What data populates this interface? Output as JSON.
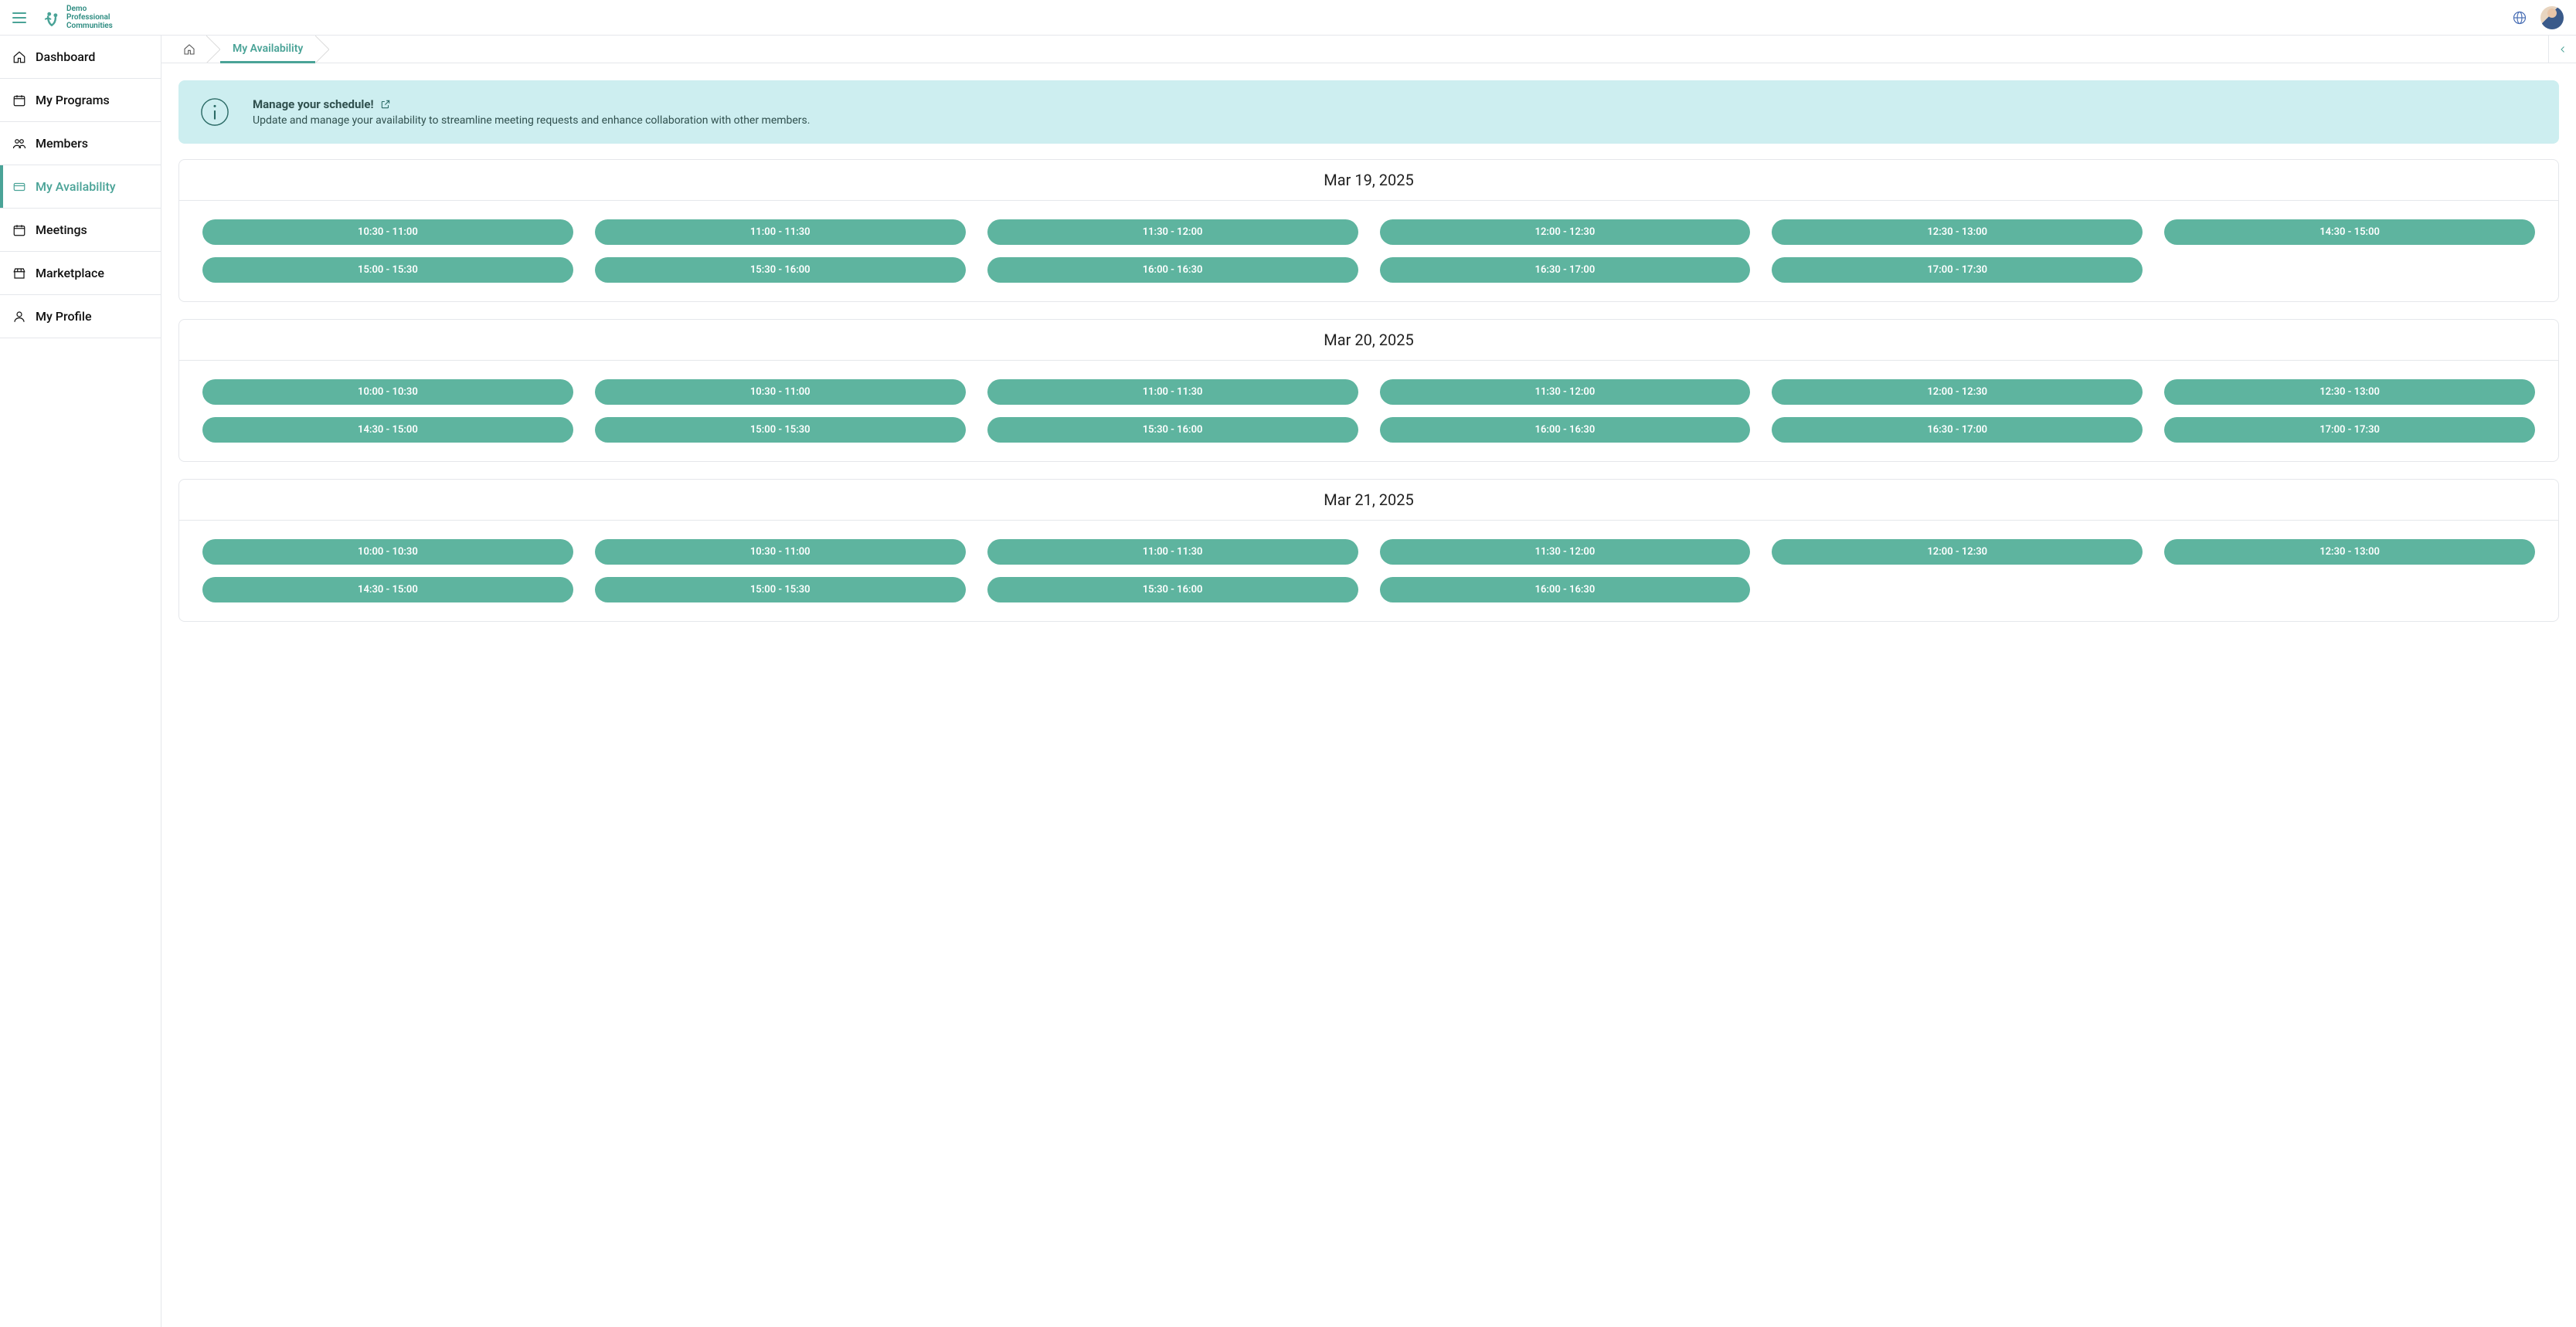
{
  "brand": {
    "line1": "Demo",
    "line2": "Professional",
    "line3": "Communities"
  },
  "sidebar": {
    "items": [
      {
        "label": "Dashboard",
        "icon": "home"
      },
      {
        "label": "My Programs",
        "icon": "calendar"
      },
      {
        "label": "Members",
        "icon": "users"
      },
      {
        "label": "My Availability",
        "icon": "card",
        "active": true
      },
      {
        "label": "Meetings",
        "icon": "calendar"
      },
      {
        "label": "Marketplace",
        "icon": "store"
      },
      {
        "label": "My Profile",
        "icon": "user"
      }
    ]
  },
  "breadcrumb": {
    "current": "My Availability"
  },
  "banner": {
    "title": "Manage your schedule!",
    "description": "Update and manage your availability to streamline meeting requests and enhance collaboration with other members."
  },
  "days": [
    {
      "date": "Mar 19, 2025",
      "slots": [
        "10:30 - 11:00",
        "11:00 - 11:30",
        "11:30 - 12:00",
        "12:00 - 12:30",
        "12:30 - 13:00",
        "14:30 - 15:00",
        "15:00 - 15:30",
        "15:30 - 16:00",
        "16:00 - 16:30",
        "16:30 - 17:00",
        "17:00 - 17:30"
      ]
    },
    {
      "date": "Mar 20, 2025",
      "slots": [
        "10:00 - 10:30",
        "10:30 - 11:00",
        "11:00 - 11:30",
        "11:30 - 12:00",
        "12:00 - 12:30",
        "12:30 - 13:00",
        "14:30 - 15:00",
        "15:00 - 15:30",
        "15:30 - 16:00",
        "16:00 - 16:30",
        "16:30 - 17:00",
        "17:00 - 17:30"
      ]
    },
    {
      "date": "Mar 21, 2025",
      "slots": [
        "10:00 - 10:30",
        "10:30 - 11:00",
        "11:00 - 11:30",
        "11:30 - 12:00",
        "12:00 - 12:30",
        "12:30 - 13:00",
        "14:30 - 15:00",
        "15:00 - 15:30",
        "15:30 - 16:00",
        "16:00 - 16:30"
      ]
    }
  ]
}
